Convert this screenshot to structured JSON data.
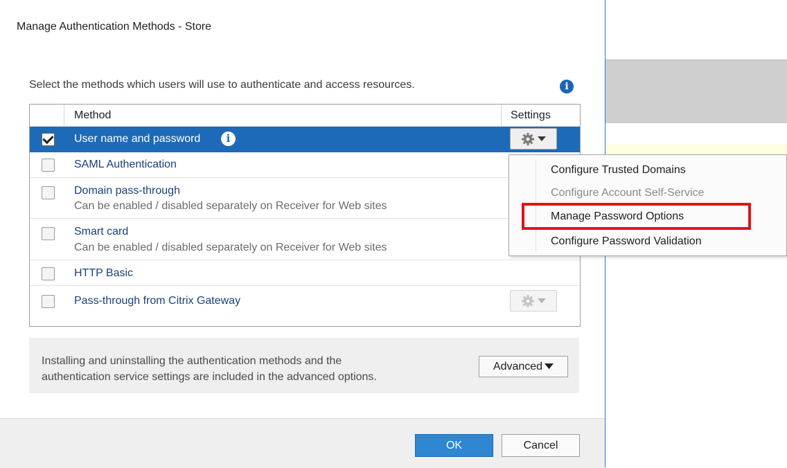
{
  "dialog": {
    "title": "Manage Authentication Methods - Store",
    "intro": "Select the methods which users will use to authenticate and access resources.",
    "info_icon": "info-icon"
  },
  "table": {
    "headers": {
      "method": "Method",
      "settings": "Settings"
    },
    "rows": [
      {
        "title": "User name and password",
        "subtitle": "",
        "checked": true,
        "selected": true,
        "has_info": true,
        "settings_button": "gear-dropdown"
      },
      {
        "title": "SAML Authentication",
        "subtitle": "",
        "checked": false,
        "selected": false
      },
      {
        "title": "Domain pass-through",
        "subtitle": "Can be enabled / disabled separately on Receiver for Web sites",
        "checked": false
      },
      {
        "title": "Smart card",
        "subtitle": "Can be enabled / disabled separately on Receiver for Web sites",
        "checked": false
      },
      {
        "title": "HTTP Basic",
        "subtitle": "",
        "checked": false
      },
      {
        "title": "Pass-through from Citrix Gateway",
        "subtitle": "",
        "checked": false,
        "settings_button": "gear-dropdown-disabled"
      }
    ]
  },
  "advanced": {
    "text_line1": "Installing and uninstalling the authentication methods and the",
    "text_line2": "authentication service settings are included in the advanced options.",
    "button_label": "Advanced"
  },
  "footer": {
    "ok_label": "OK",
    "cancel_label": "Cancel"
  },
  "context_menu": {
    "items": [
      {
        "label": "Configure Trusted Domains",
        "enabled": true
      },
      {
        "label": "Configure Account Self-Service",
        "enabled": false
      },
      {
        "label": "Manage Password Options",
        "enabled": true,
        "highlighted": true
      },
      {
        "label": "Configure Password Validation",
        "enabled": true
      }
    ]
  },
  "colors": {
    "selection": "#1c6ab8",
    "primary_button": "#2f86d1",
    "highlight_box": "#e2141a"
  }
}
